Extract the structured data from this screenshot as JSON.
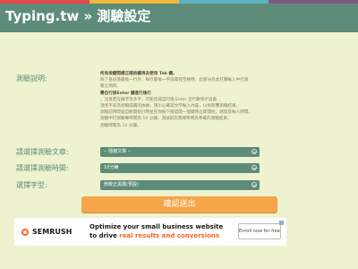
{
  "header": {
    "title": "Typing.tw » 測驗設定",
    "stripe_colors": [
      "#e4474c",
      "#f0b73c",
      "#5fb0c0",
      "#7b5a7e"
    ]
  },
  "form": {
    "description_label": "測驗說明:",
    "description_lines": [
      {
        "text": "所有按鍵間請正確按鍵再去使用 Tab 鍵。",
        "bold": true
      },
      {
        "text": "除了各段落最後一行外，每行最後一字前需有空格時，此部分為此打實輸入中打測",
        "bold": false
      },
      {
        "text": "驗之項目。",
        "bold": false
      },
      {
        "text": "需自行按Enter 鍵進行換行",
        "bold": true
      },
      {
        "text": "。注意若在線字及多字，可能造成自行換 Enter 全行數值示沒處...",
        "bold": false
      },
      {
        "text": "須考字表為測驗成績的依據，請小心確認文字輸入內容，以免影響測驗結果。",
        "bold": false
      },
      {
        "text": "測驗前時間會自動開始計時並在你按下確認開一個鍵時立即開始，請留意輸入時間。",
        "bold": false
      },
      {
        "text": "測驗中打測驗專時間為 10 分鐘，測試前您需要準時為準確的測驗結果。",
        "bold": false
      },
      {
        "text": "測驗時間為 10 分鐘。",
        "bold": false
      }
    ],
    "article_label": "請選擇測驗文章:",
    "article_value": "-- 隨機文章 --",
    "time_label": "請選擇測驗時間:",
    "time_value": "10分鐘",
    "font_label": "選擇字型:",
    "font_value": "微軟正黑體(預設)",
    "submit_label": "確認送出"
  },
  "ad": {
    "brand": "SEMRUSH",
    "headline": "Optimize your small business website",
    "sub_prefix": "to drive ",
    "sub_highlight": "real results and conversions",
    "cta": "Enroll now for free",
    "accent": "#ff6422"
  }
}
